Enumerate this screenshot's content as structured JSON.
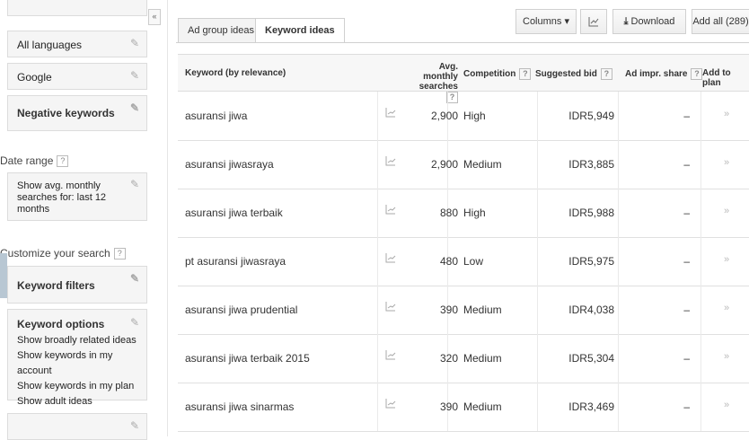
{
  "sidebar": {
    "language": "All languages",
    "network": "Google",
    "negative_keywords": "Negative keywords",
    "date_range_label": "Date range",
    "date_range_value": "Show avg. monthly searches for: last 12 months",
    "customize_label": "Customize your search",
    "keyword_filters": "Keyword filters",
    "keyword_options": "Keyword options",
    "options": [
      "Show broadly related ideas",
      "Show keywords in my account",
      "Show keywords in my plan",
      "Show adult ideas"
    ],
    "help_glyph": "?",
    "collapse_glyph": "«"
  },
  "tabs": [
    {
      "label": "Ad group ideas"
    },
    {
      "label": "Keyword ideas"
    }
  ],
  "toolbar": {
    "columns": "Columns ▾",
    "download": "Download",
    "add_all": "Add all (289)"
  },
  "table": {
    "headers": {
      "keyword": "Keyword (by relevance)",
      "searches": "Avg. monthly searches",
      "competition": "Competition",
      "bid": "Suggested bid",
      "impr": "Ad impr. share",
      "add": "Add to plan"
    },
    "rows": [
      {
        "keyword": "asuransi jiwa",
        "searches": "2,900",
        "competition": "High",
        "bid": "IDR5,949",
        "impr": "–"
      },
      {
        "keyword": "asuransi jiwasraya",
        "searches": "2,900",
        "competition": "Medium",
        "bid": "IDR3,885",
        "impr": "–"
      },
      {
        "keyword": "asuransi jiwa terbaik",
        "searches": "880",
        "competition": "High",
        "bid": "IDR5,988",
        "impr": "–"
      },
      {
        "keyword": "pt asuransi jiwasraya",
        "searches": "480",
        "competition": "Low",
        "bid": "IDR5,975",
        "impr": "–"
      },
      {
        "keyword": "asuransi jiwa prudential",
        "searches": "390",
        "competition": "Medium",
        "bid": "IDR4,038",
        "impr": "–"
      },
      {
        "keyword": "asuransi jiwa terbaik 2015",
        "searches": "320",
        "competition": "Medium",
        "bid": "IDR5,304",
        "impr": "–"
      },
      {
        "keyword": "asuransi jiwa sinarmas",
        "searches": "390",
        "competition": "Medium",
        "bid": "IDR3,469",
        "impr": "–"
      }
    ],
    "add_glyph": "»"
  }
}
